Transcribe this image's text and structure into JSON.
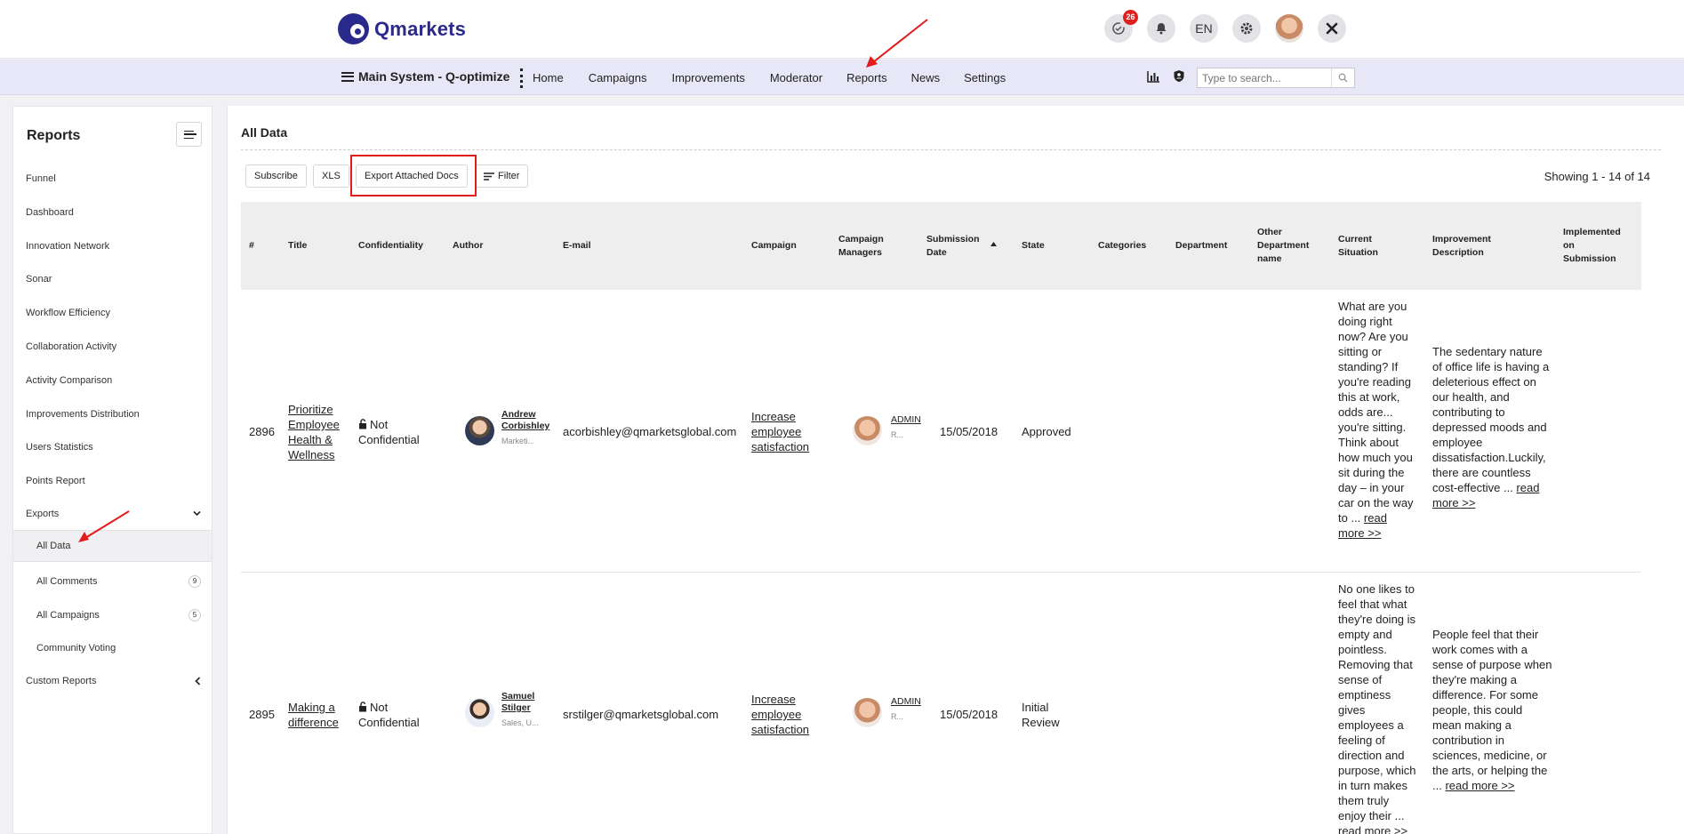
{
  "brand": {
    "name": "Qmarkets"
  },
  "top_icons": {
    "tasks_badge": "26",
    "language": "EN"
  },
  "navbar": {
    "system_name": "Main System - Q-optimize",
    "links": [
      "Home",
      "Campaigns",
      "Improvements",
      "Moderator",
      "Reports",
      "News",
      "Settings"
    ],
    "search_placeholder": "Type to search..."
  },
  "sidebar": {
    "title": "Reports",
    "items": [
      "Funnel",
      "Dashboard",
      "Innovation Network",
      "Sonar",
      "Workflow Efficiency",
      "Collaboration Activity",
      "Activity Comparison",
      "Improvements Distribution",
      "Users Statistics",
      "Points Report",
      "Exports"
    ],
    "exports_sub": [
      {
        "label": "All Data",
        "count": ""
      },
      {
        "label": "All Comments",
        "count": "9"
      },
      {
        "label": "All Campaigns",
        "count": "5"
      },
      {
        "label": "Community Voting",
        "count": ""
      }
    ],
    "custom_reports": "Custom Reports"
  },
  "main": {
    "title": "All Data",
    "buttons": {
      "subscribe": "Subscribe",
      "xls": "XLS",
      "export_docs": "Export Attached Docs",
      "filter": "Filter"
    },
    "showing": "Showing 1 - 14 of 14"
  },
  "table": {
    "columns": [
      "#",
      "Title",
      "Confidentiality",
      "Author",
      "E-mail",
      "Campaign",
      "Campaign Managers",
      "Submission Date",
      "State",
      "Categories",
      "Department",
      "Other Department name",
      "Current Situation",
      "Improvement Description",
      "Implemented on Submission"
    ],
    "rows": [
      {
        "id": "2896",
        "title": "Prioritize Employee Health & Wellness",
        "confidentiality": "Not Confidential",
        "author_name": "Andrew Corbishley",
        "author_sub": "Marketi...",
        "email": "acorbishley@qmarketsglobal.com",
        "campaign": "Increase employee satisfaction",
        "manager": "ADMIN",
        "manager_sub": "R...",
        "date": "15/05/2018",
        "state": "Approved",
        "current_situation": "What are you doing right now? Are you sitting or standing? If you're reading this at work, odds are... you're sitting. Think about how much you sit during the day – in your car on the way to ...",
        "improvement": "The sedentary nature of office life is having a deleterious effect on our health, and contributing to depressed moods and employee dissatisfaction.Luckily, there are countless cost-effective ...",
        "read_more": "read more >>"
      },
      {
        "id": "2895",
        "title": "Making a difference",
        "confidentiality": "Not Confidential",
        "author_name": "Samuel Stilger",
        "author_sub": "Sales, U...",
        "email": "srstilger@qmarketsglobal.com",
        "campaign": "Increase employee satisfaction",
        "manager": "ADMIN",
        "manager_sub": "R...",
        "date": "15/05/2018",
        "state": "Initial Review",
        "current_situation": "No one likes to feel that what they're doing is empty and pointless. Removing that sense of emptiness gives employees a feeling of direction and purpose, which in turn makes them truly enjoy their ...",
        "improvement": "People feel that their work comes with a sense of purpose when they're making a difference. For some people, this could mean making a contribution in sciences, medicine, or the arts, or helping the ...",
        "read_more": "read more >>"
      }
    ]
  },
  "colors": {
    "brand": "#2a2a8c",
    "nav_bg": "#e7e7f7",
    "annotation": "#e21b1b"
  }
}
